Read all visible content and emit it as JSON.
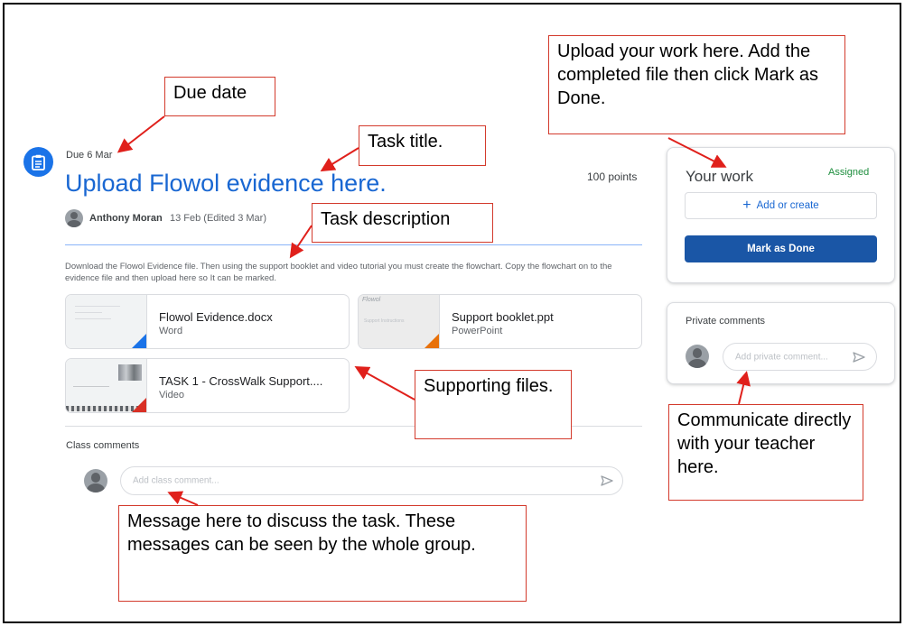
{
  "assignment": {
    "due": "Due 6 Mar",
    "title": "Upload Flowol evidence here.",
    "points": "100 points",
    "author": "Anthony Moran",
    "date": "13 Feb (Edited 3 Mar)",
    "description": "Download the Flowol Evidence file. Then using the support booklet and video tutorial you must create the flowchart. Copy the flowchart on to the evidence file and then upload here so It can be marked."
  },
  "attachments": [
    {
      "name": "Flowol Evidence.docx",
      "type": "Word",
      "color": "#1a73e8"
    },
    {
      "name": "Support booklet.ppt",
      "type": "PowerPoint",
      "color": "#e8710a",
      "thumb_title": "Flowol",
      "thumb_text": "Support Instructions"
    },
    {
      "name": "TASK 1 - CrossWalk Support....",
      "type": "Video",
      "color": "#d93025"
    }
  ],
  "class_comments": {
    "label": "Class comments",
    "placeholder": "Add class comment..."
  },
  "your_work": {
    "title": "Your work",
    "status": "Assigned",
    "add_label": "Add or create",
    "done_label": "Mark as Done"
  },
  "private_comments": {
    "label": "Private comments",
    "placeholder": "Add private comment..."
  },
  "callouts": {
    "due": "Due date",
    "title": "Task title.",
    "description": "Task description",
    "upload": "Upload your work here. Add the completed file then click Mark as Done.",
    "supporting": "Supporting files.",
    "communicate": "Communicate directly with your teacher here.",
    "message": "Message here to discuss the task. These messages can be seen by the whole group."
  },
  "colors": {
    "accent": "#1a73e8",
    "title": "#1967d2",
    "done_button": "#1a56a6",
    "assigned": "#1e8e3e",
    "callout_border": "#d33a2c"
  }
}
